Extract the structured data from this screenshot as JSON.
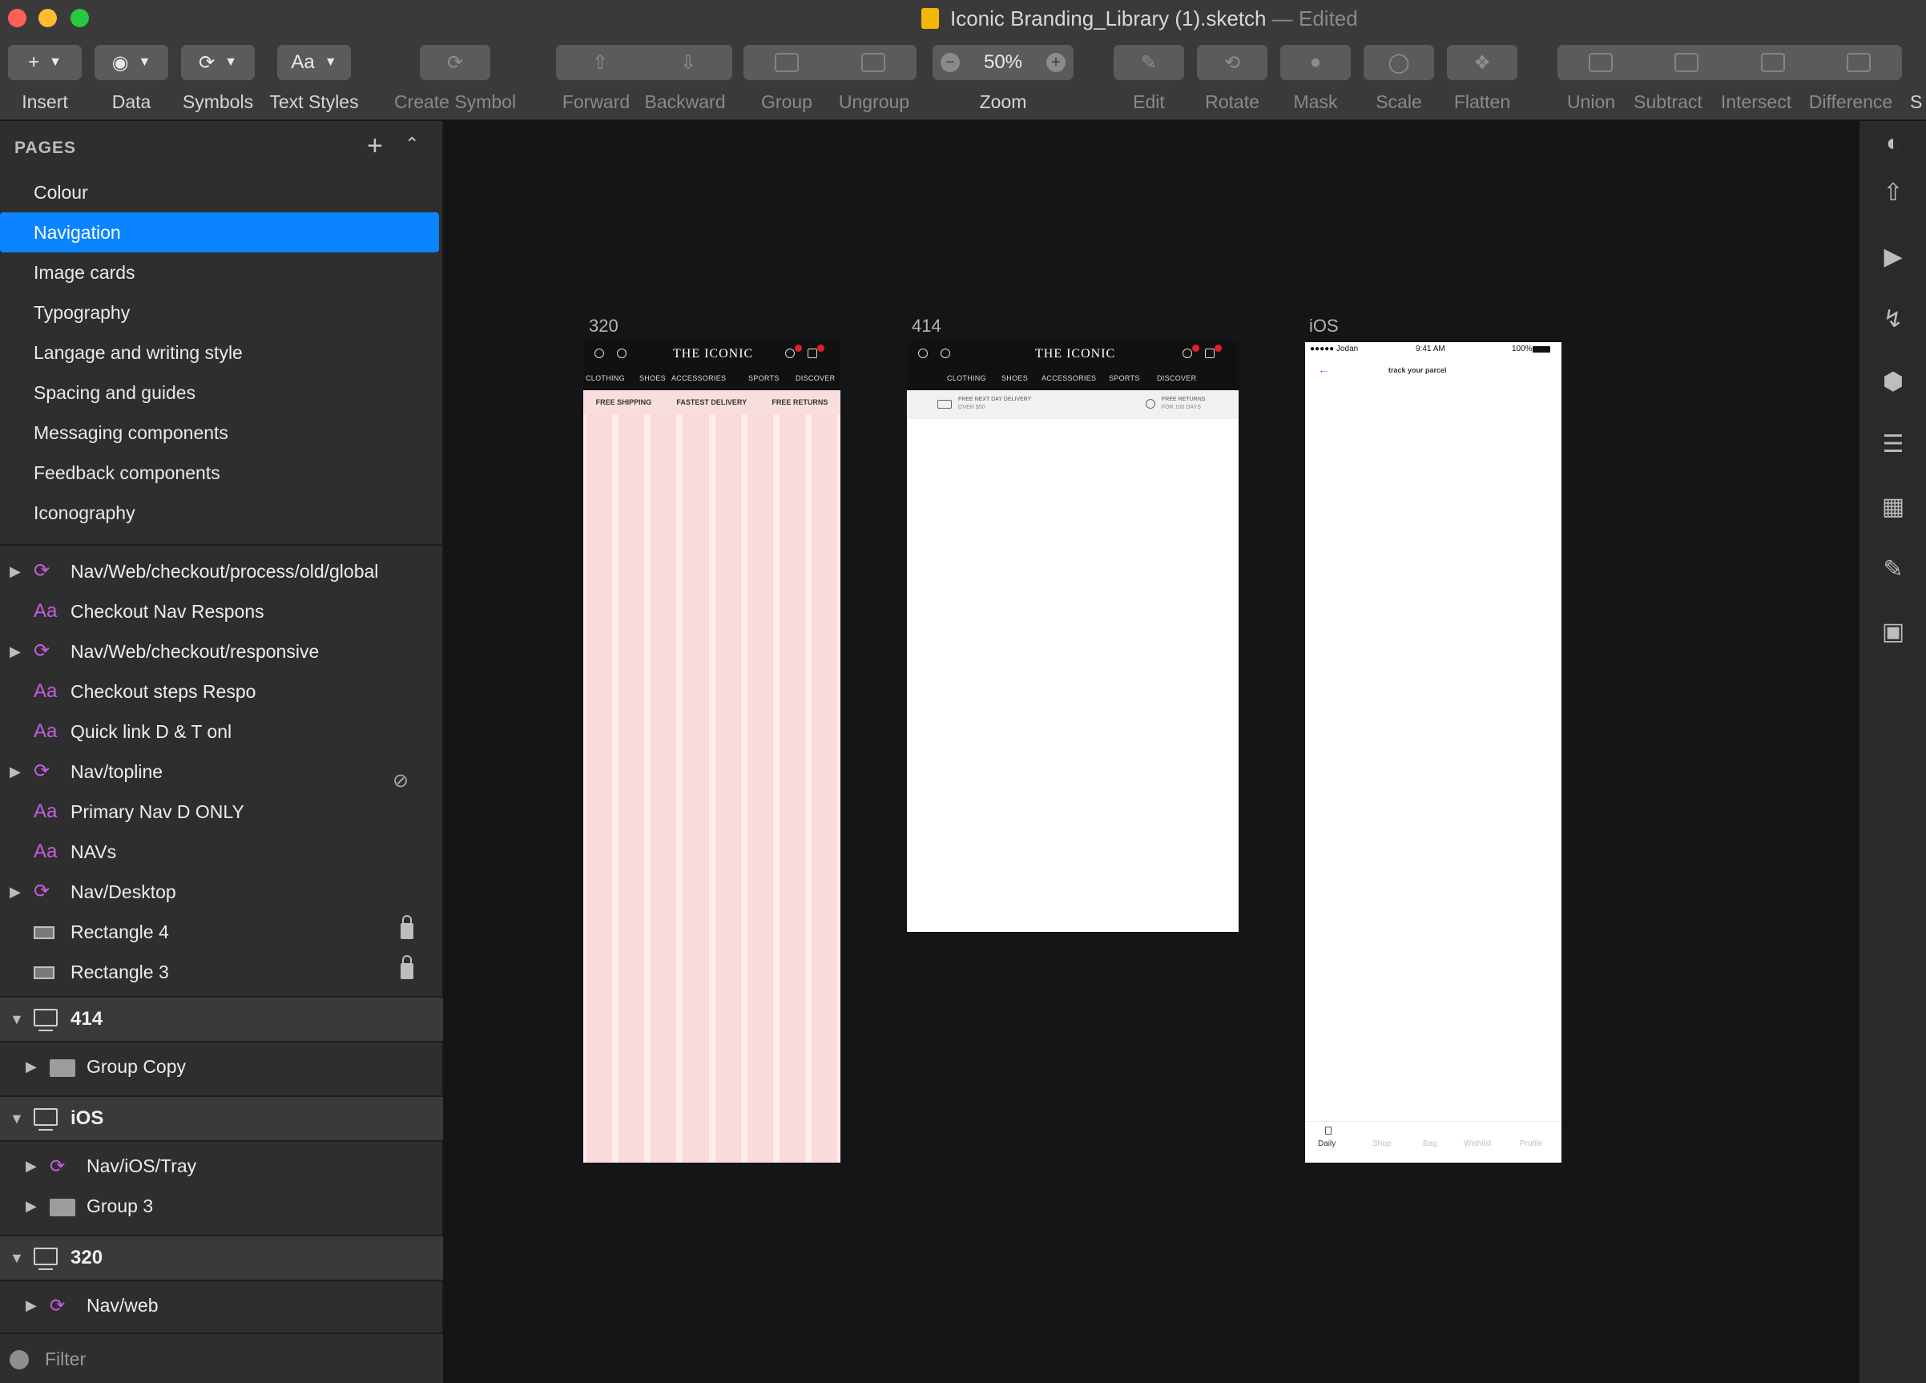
{
  "window": {
    "title": "Iconic Branding_Library (1).sketch",
    "status": "— Edited"
  },
  "toolbar": {
    "insert": "Insert",
    "data": "Data",
    "symbols": "Symbols",
    "text_styles": "Text Styles",
    "text_styles_glyph": "Aa",
    "create_symbol": "Create Symbol",
    "forward": "Forward",
    "backward": "Backward",
    "group": "Group",
    "ungroup": "Ungroup",
    "zoom": "Zoom",
    "zoom_value": "50%",
    "edit": "Edit",
    "rotate": "Rotate",
    "mask": "Mask",
    "scale": "Scale",
    "flatten": "Flatten",
    "union": "Union",
    "subtract": "Subtract",
    "intersect": "Intersect",
    "difference": "Difference",
    "overflow": "S"
  },
  "sidebar": {
    "pages_header": "PAGES",
    "pages": [
      {
        "label": "Colour"
      },
      {
        "label": "Navigation"
      },
      {
        "label": "Image cards"
      },
      {
        "label": "Typography"
      },
      {
        "label": "Langage and writing style"
      },
      {
        "label": "Spacing and guides"
      },
      {
        "label": "Messaging components"
      },
      {
        "label": "Feedback components"
      },
      {
        "label": "Iconography"
      }
    ],
    "layers": [
      {
        "label": "Nav/Web/checkout/process/old/global"
      },
      {
        "label": "Checkout Nav Respons"
      },
      {
        "label": "Nav/Web/checkout/responsive"
      },
      {
        "label": "Checkout steps Respo"
      },
      {
        "label": "Quick link D & T onl"
      },
      {
        "label": "Nav/topline"
      },
      {
        "label": "Primary Nav D ONLY"
      },
      {
        "label": "NAVs"
      },
      {
        "label": "Nav/Desktop"
      },
      {
        "label": "Rectangle 4"
      },
      {
        "label": "Rectangle 3"
      }
    ],
    "text_glyph": "Aa",
    "artboards": [
      {
        "label": "414",
        "children": [
          {
            "label": "Group Copy"
          }
        ]
      },
      {
        "label": "iOS",
        "children": [
          {
            "label": "Nav/iOS/Tray"
          },
          {
            "label": "Group 3"
          }
        ]
      },
      {
        "label": "320",
        "children": [
          {
            "label": "Nav/web"
          }
        ]
      }
    ],
    "filter": "Filter"
  },
  "canvas": {
    "ab320": {
      "label": "320",
      "logo": "THE ICONIC",
      "nav": [
        "CLOTHING",
        "SHOES",
        "ACCESSORIES",
        "SPORTS",
        "DISCOVER"
      ],
      "promo": [
        "FREE SHIPPING",
        "FASTEST DELIVERY",
        "FREE RETURNS"
      ]
    },
    "ab414": {
      "label": "414",
      "logo": "THE ICONIC",
      "nav": [
        "CLOTHING",
        "SHOES",
        "ACCESSORIES",
        "SPORTS",
        "DISCOVER"
      ],
      "promo_left": "FREE NEXT DAY DELIVERY",
      "promo_left_sub": "OVER $50",
      "promo_right": "FREE RETURNS",
      "promo_right_sub": "FOR 100 DAYS"
    },
    "abios": {
      "label": "iOS",
      "carrier": "●●●●● Jodan",
      "time": "9:41 AM",
      "battery": "100%",
      "title": "track your parcel",
      "tabs": [
        "Daily",
        "Shop",
        "Bag",
        "Wishlist",
        "Profile"
      ]
    }
  },
  "colors": {
    "accent": "#0a84ff",
    "symbol": "#c45ee0",
    "canvas": "#141517"
  }
}
